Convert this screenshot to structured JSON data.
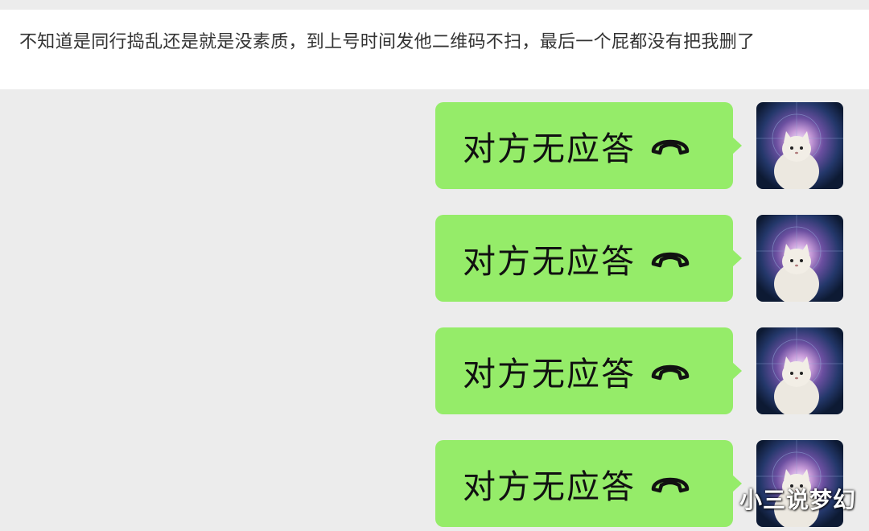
{
  "post": {
    "caption": "不知道是同行捣乱还是就是没素质，到上号时间发他二维码不扫，最后一个屁都没有把我删了"
  },
  "chat": {
    "messages": [
      {
        "text": "对方无应答",
        "icon": "phone-hangup-icon",
        "sender": "self"
      },
      {
        "text": "对方无应答",
        "icon": "phone-hangup-icon",
        "sender": "self"
      },
      {
        "text": "对方无应答",
        "icon": "phone-hangup-icon",
        "sender": "self"
      },
      {
        "text": "对方无应答",
        "icon": "phone-hangup-icon",
        "sender": "self"
      }
    ],
    "avatar": {
      "icon": "cat-avatar-icon"
    }
  },
  "watermark": {
    "text": "小三说梦幻"
  },
  "colors": {
    "background": "#ececec",
    "caption_background": "#ffffff",
    "bubble_green": "#95ec69",
    "text_dark": "#111111"
  }
}
